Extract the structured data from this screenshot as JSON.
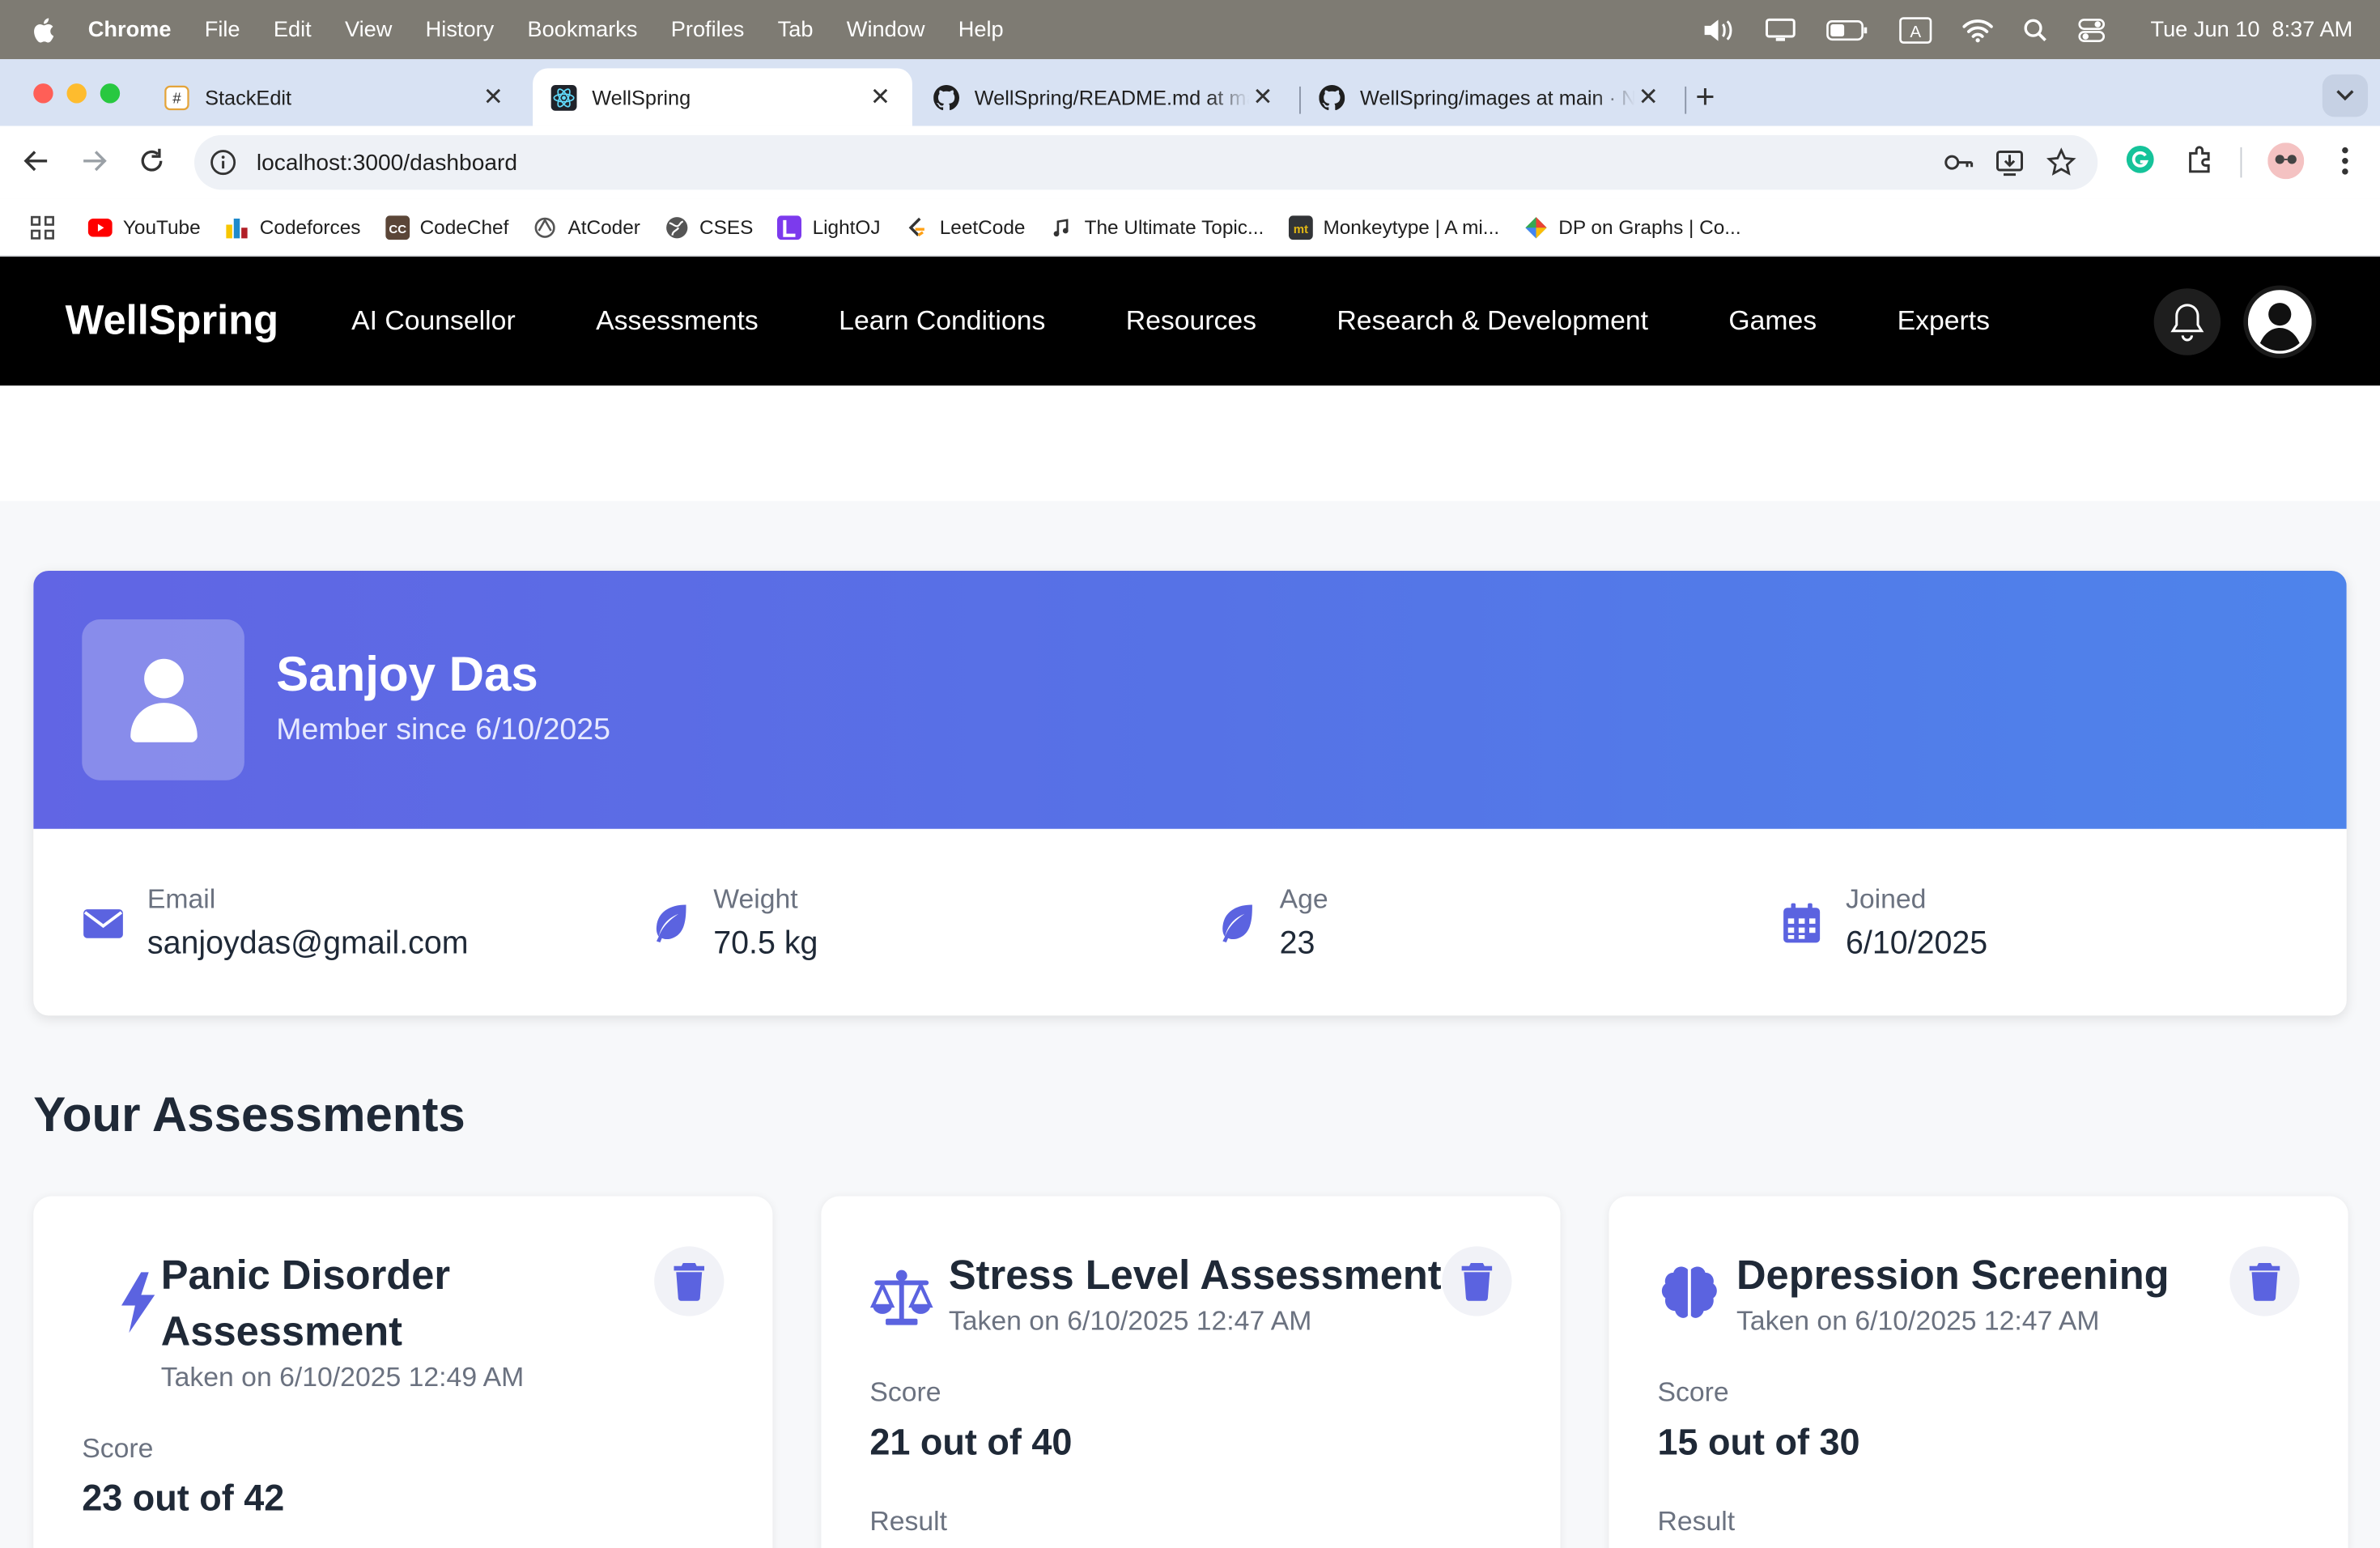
{
  "menubar": {
    "app": "Chrome",
    "menus": [
      "File",
      "Edit",
      "View",
      "History",
      "Bookmarks",
      "Profiles",
      "Tab",
      "Window",
      "Help"
    ],
    "date": "Tue Jun 10",
    "time": "8:37 AM",
    "input_indicator": "A"
  },
  "tabs": [
    {
      "title": "StackEdit",
      "icon": "stackedit-icon"
    },
    {
      "title": "WellSpring",
      "icon": "react-icon",
      "active": true
    },
    {
      "title": "WellSpring/README.md at main · N",
      "icon": "github-icon"
    },
    {
      "title": "WellSpring/images at main · N",
      "icon": "github-icon"
    }
  ],
  "address": {
    "url": "localhost:3000/dashboard"
  },
  "bookmarks": [
    {
      "label": "YouTube",
      "color": "#ff0000"
    },
    {
      "label": "Codeforces",
      "color": "#1f8acb"
    },
    {
      "label": "CodeChef",
      "color": "#5b4638"
    },
    {
      "label": "AtCoder",
      "color": "#555555"
    },
    {
      "label": "CSES",
      "color": "#444444"
    },
    {
      "label": "LightOJ",
      "color": "#7c3aed"
    },
    {
      "label": "LeetCode",
      "color": "#ffa116"
    },
    {
      "label": "The Ultimate Topic...",
      "color": "#222222"
    },
    {
      "label": "Monkeytype | A mi...",
      "color": "#e2b714"
    },
    {
      "label": "DP on Graphs | Co...",
      "color": "#34a853"
    }
  ],
  "nav": {
    "brand": "WellSpring",
    "links": [
      "AI Counsellor",
      "Assessments",
      "Learn Conditions",
      "Resources",
      "Research & Development",
      "Games",
      "Experts"
    ]
  },
  "profile": {
    "name": "Sanjoy Das",
    "member_since": "Member since 6/10/2025",
    "stats": [
      {
        "label": "Email",
        "value": "sanjoydas@gmail.com",
        "icon": "envelope-icon"
      },
      {
        "label": "Weight",
        "value": "70.5 kg",
        "icon": "leaf-icon"
      },
      {
        "label": "Age",
        "value": "23",
        "icon": "leaf-icon"
      },
      {
        "label": "Joined",
        "value": "6/10/2025",
        "icon": "calendar-icon"
      }
    ]
  },
  "assessments": {
    "title": "Your Assessments",
    "items": [
      {
        "title": "Panic Disorder Assessment",
        "date": "Taken on 6/10/2025 12:49 AM",
        "score_label": "Score",
        "score": "23 out of 42",
        "icon": "bolt-icon"
      },
      {
        "title": "Stress Level Assessment",
        "date": "Taken on 6/10/2025 12:47 AM",
        "score_label": "Score",
        "score": "21 out of 40",
        "result_label": "Result",
        "icon": "scale-icon"
      },
      {
        "title": "Depression Screening",
        "date": "Taken on 6/10/2025 12:47 AM",
        "score_label": "Score",
        "score": "15 out of 30",
        "result_label": "Result",
        "icon": "brain-icon"
      }
    ]
  },
  "colors": {
    "accent": "#5b63e0",
    "gradient_start": "#6165e4",
    "gradient_end": "#4e84eb",
    "nav_bg": "#000000"
  }
}
